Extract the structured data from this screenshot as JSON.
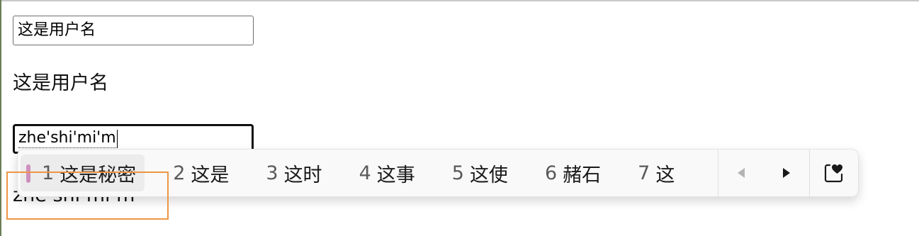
{
  "username": {
    "value": "这是用户名",
    "echo": "这是用户名"
  },
  "password": {
    "composition": "zhe'shi'mi'm",
    "echo": "zhe shi mi m"
  },
  "ime": {
    "candidates": [
      {
        "num": "1",
        "word": "这是秘密",
        "selected": true
      },
      {
        "num": "2",
        "word": "这是"
      },
      {
        "num": "3",
        "word": "这时"
      },
      {
        "num": "4",
        "word": "这事"
      },
      {
        "num": "5",
        "word": "这使"
      },
      {
        "num": "6",
        "word": "赭石"
      },
      {
        "num": "7",
        "word": "这"
      }
    ],
    "icons": {
      "prev": "triangle-left-icon",
      "next": "triangle-right-icon",
      "favorite": "heart-bookmark-icon"
    },
    "colors": {
      "selection_marker": "#cf8fbf",
      "highlight_box": "#ee9644"
    }
  }
}
